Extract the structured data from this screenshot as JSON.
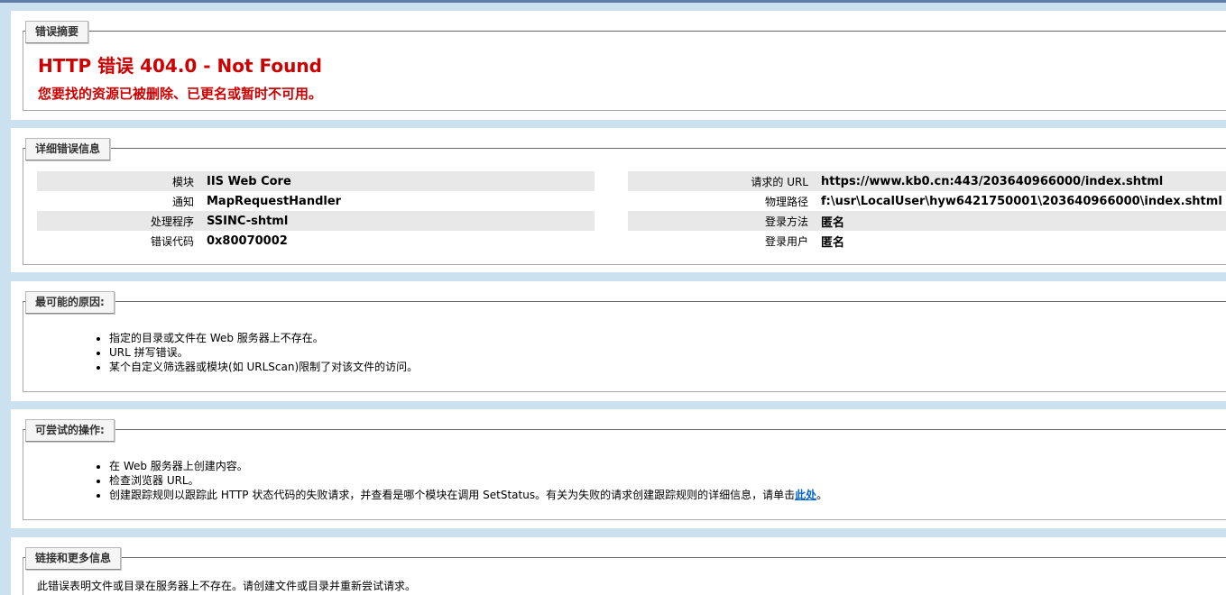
{
  "summary": {
    "legend": "错误摘要",
    "title": "HTTP 错误 404.0 - Not Found",
    "subtitle": "您要找的资源已被删除、已更名或暂时不可用。"
  },
  "details": {
    "legend": "详细错误信息",
    "left": [
      {
        "label": "模块",
        "value": "IIS Web Core"
      },
      {
        "label": "通知",
        "value": "MapRequestHandler"
      },
      {
        "label": "处理程序",
        "value": "SSINC-shtml"
      },
      {
        "label": "错误代码",
        "value": "0x80070002"
      }
    ],
    "right": [
      {
        "label": "请求的 URL",
        "value": "https://www.kb0.cn:443/203640966000/index.shtml"
      },
      {
        "label": "物理路径",
        "value": "f:\\usr\\LocalUser\\hyw6421750001\\203640966000\\index.shtml"
      },
      {
        "label": "登录方法",
        "value": "匿名"
      },
      {
        "label": "登录用户",
        "value": "匿名"
      }
    ]
  },
  "causes": {
    "legend": "最可能的原因:",
    "items": [
      "指定的目录或文件在 Web 服务器上不存在。",
      "URL 拼写错误。",
      "某个自定义筛选器或模块(如 URLScan)限制了对该文件的访问。"
    ]
  },
  "actions": {
    "legend": "可尝试的操作:",
    "items": [
      "在 Web 服务器上创建内容。",
      "检查浏览器 URL。"
    ],
    "item3_text": "创建跟踪规则以跟踪此 HTTP 状态代码的失败请求，并查看是哪个模块在调用 SetStatus。有关为失败的请求创建跟踪规则的详细信息，请单击",
    "item3_link": "此处",
    "item3_end": "。"
  },
  "more": {
    "legend": "链接和更多信息",
    "text": "此错误表明文件或目录在服务器上不存在。请创建文件或目录并重新尝试请求。"
  }
}
